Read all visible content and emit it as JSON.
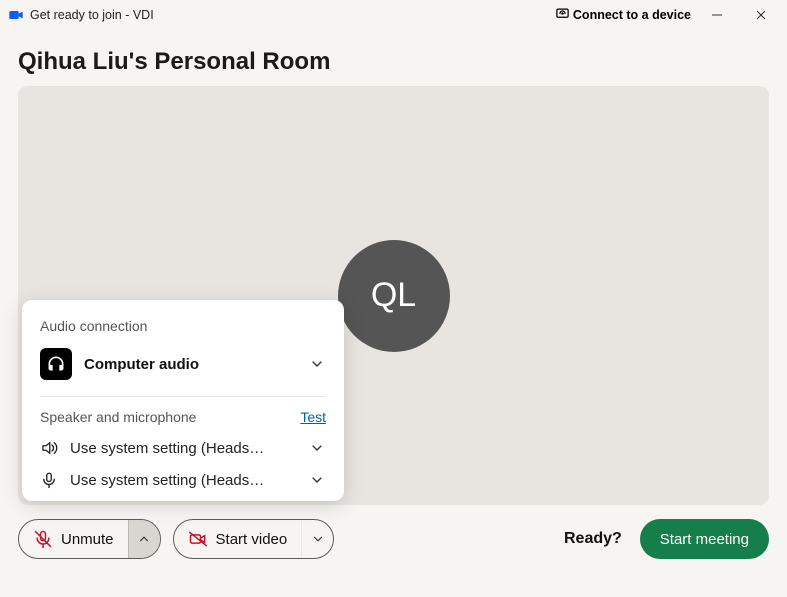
{
  "window": {
    "title": "Get ready to join - VDI"
  },
  "header": {
    "connect_label": "Connect to a device"
  },
  "room": {
    "title": "Qihua Liu's Personal Room",
    "avatar_initials": "QL"
  },
  "audio_panel": {
    "title": "Audio connection",
    "mode_label": "Computer audio",
    "section_label": "Speaker and microphone",
    "test_link": "Test",
    "speaker": "Use system setting (Headset ...",
    "microphone": "Use system setting (Headset ..."
  },
  "controls": {
    "unmute_label": "Unmute",
    "start_video_label": "Start video",
    "ready_label": "Ready?",
    "start_meeting_label": "Start meeting"
  },
  "colors": {
    "primary_green": "#157e4a",
    "stage_bg": "#e8e4df",
    "danger_red": "#c8102e"
  }
}
